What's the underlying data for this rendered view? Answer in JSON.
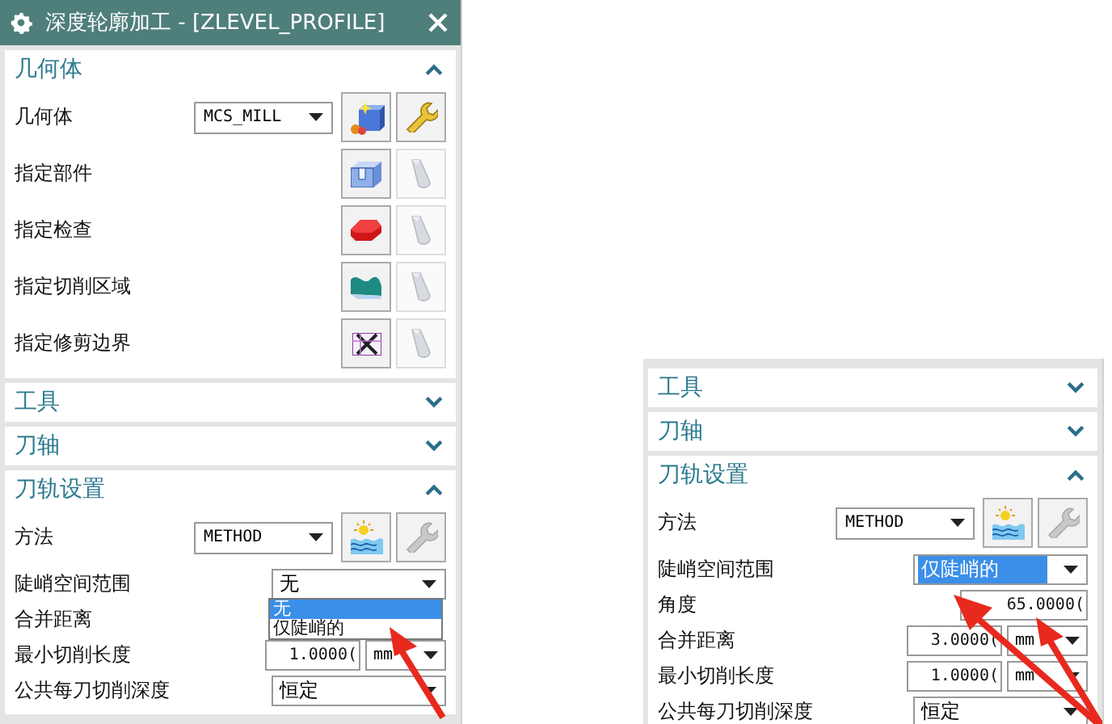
{
  "panels": [
    {
      "title_bar": {
        "title": "深度轮廓加工 - [ZLEVEL_PROFILE]"
      },
      "sections": [
        {
          "title": "几何体",
          "expanded": true,
          "rows": [
            {
              "kind": "select-icons",
              "label": "几何体",
              "value": "MCS_MILL",
              "edit_disabled": false
            },
            {
              "kind": "icons",
              "label": "指定部件",
              "show_disabled": true
            },
            {
              "kind": "icons",
              "label": "指定检查",
              "show_disabled": true
            },
            {
              "kind": "icons",
              "label": "指定切削区域",
              "show_disabled": true
            },
            {
              "kind": "icons",
              "label": "指定修剪边界",
              "show_disabled": true
            }
          ]
        },
        {
          "title": "工具",
          "expanded": false
        },
        {
          "title": "刀轴",
          "expanded": false
        },
        {
          "title": "刀轨设置",
          "expanded": true,
          "rows": [
            {
              "kind": "select-icons",
              "label": "方法",
              "value": "METHOD",
              "edit_disabled": true
            },
            {
              "kind": "dropdown",
              "label": "陡峭空间范围",
              "value": "无",
              "highlighted": false,
              "options": [
                {
                  "label": "无",
                  "selected": true
                },
                {
                  "label": "仅陡峭的",
                  "selected": false
                }
              ]
            },
            {
              "kind": "label",
              "label": "合并距离"
            },
            {
              "kind": "number-unit",
              "label": "最小切削长度",
              "value": "1.0000(",
              "unit": "mm"
            },
            {
              "kind": "dropdown",
              "label": "公共每刀切削深度",
              "value": "恒定",
              "highlighted": false
            }
          ]
        }
      ]
    },
    {
      "sections": [
        {
          "title": "工具",
          "expanded": false
        },
        {
          "title": "刀轴",
          "expanded": false
        },
        {
          "title": "刀轨设置",
          "expanded": true,
          "rows": [
            {
              "kind": "select-icons",
              "label": "方法",
              "value": "METHOD",
              "edit_disabled": true
            },
            {
              "kind": "dropdown",
              "label": "陡峭空间范围",
              "value": "仅陡峭的",
              "highlighted": true
            },
            {
              "kind": "number",
              "label": "角度",
              "value": "65.0000("
            },
            {
              "kind": "number-unit",
              "label": "合并距离",
              "value": "3.0000(",
              "unit": "mm"
            },
            {
              "kind": "number-unit",
              "label": "最小切削长度",
              "value": "1.0000(",
              "unit": "mm"
            },
            {
              "kind": "dropdown",
              "label": "公共每刀切削深度",
              "value": "恒定",
              "highlighted": false
            }
          ]
        }
      ]
    }
  ]
}
